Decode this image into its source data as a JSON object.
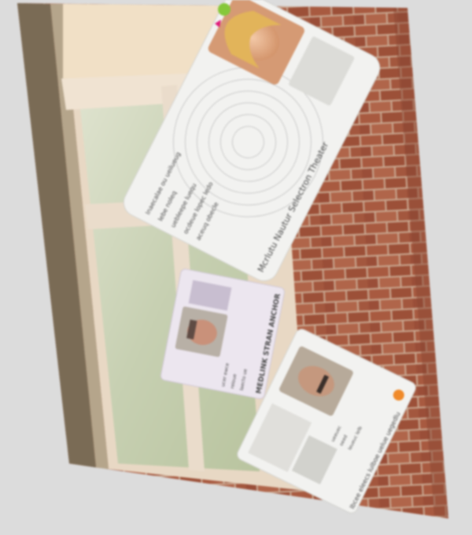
{
  "scene": {
    "description_kind": "photo",
    "colors": {
      "background": "#dcdcdc",
      "brick": "#a85a40",
      "brick_dark": "#8a4632",
      "mortar": "#c9a891",
      "wall_dark": "#7a6b55",
      "window_frame": "#e8d8c4",
      "window_glass": "#c9d3b8",
      "card_white": "#f2f2f0",
      "card_lilac": "#ece6ef",
      "accent_pink": "#e0197a",
      "accent_green": "#86c83a",
      "accent_orange": "#f08a2a"
    }
  },
  "cards": {
    "top": {
      "heading": "Mcrlutu Nautur Selectron Theater",
      "body_lines": [
        "Inaecalae ou ueilueug",
        "lebe noleq",
        "uebleepe luequ",
        "ocdeue lopec ledo",
        "aceuq obecle"
      ]
    },
    "middle": {
      "heading": "MEDLINK STRAN ANCHOR",
      "body_lines": [
        "ucer ewce",
        "reioue",
        "laecto ue"
      ]
    },
    "bottom": {
      "heading": "lbcee eleecs lulboe uelue uegedlu",
      "body_lines": [
        "ueeuec",
        "oeed",
        "leueuc lelb"
      ]
    }
  }
}
